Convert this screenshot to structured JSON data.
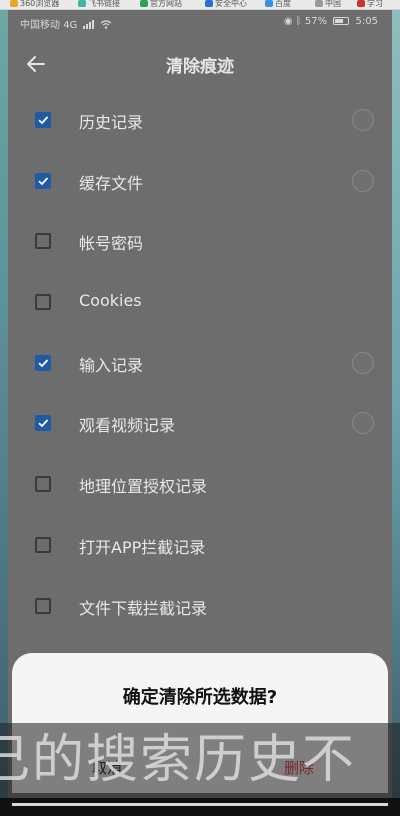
{
  "tabstrip": {
    "tabs": [
      "360浏览器",
      "飞书链接",
      "官方网站",
      "安全中心",
      "百度",
      "中国",
      "学习"
    ]
  },
  "status": {
    "carrier": "中国移动",
    "network": "4G",
    "battery": "57%",
    "time": "5:05"
  },
  "header": {
    "title": "清除痕迹"
  },
  "items": [
    {
      "label": "历史记录",
      "checked": true,
      "radio": true
    },
    {
      "label": "缓存文件",
      "checked": true,
      "radio": true
    },
    {
      "label": "帐号密码",
      "checked": false,
      "radio": false
    },
    {
      "label": "Cookies",
      "checked": false,
      "radio": false
    },
    {
      "label": "输入记录",
      "checked": true,
      "radio": true
    },
    {
      "label": "观看视频记录",
      "checked": true,
      "radio": true
    },
    {
      "label": "地理位置授权记录",
      "checked": false,
      "radio": false
    },
    {
      "label": "打开APP拦截记录",
      "checked": false,
      "radio": false
    },
    {
      "label": "文件下载拦截记录",
      "checked": false,
      "radio": false
    }
  ],
  "dialog": {
    "title": "确定清除所选数据?",
    "cancel": "取消",
    "confirm": "删除"
  },
  "subtitle": "己的搜索历史不",
  "colors": {
    "accent": "#1e5aa6",
    "danger": "#e03a3a"
  }
}
